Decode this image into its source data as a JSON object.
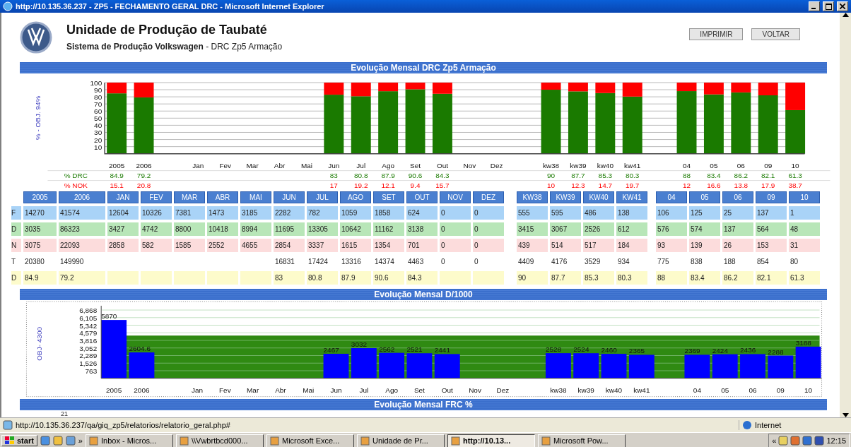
{
  "window": {
    "title": "http://10.135.36.237 - ZP5 - FECHAMENTO GERAL DRC - Microsoft Internet Explorer"
  },
  "header": {
    "title": "Unidade de Produção de Taubaté",
    "subtitle": "**Sistema de Produção Volkswagen** - DRC Zp5 Armação",
    "buttons": [
      "IMPRIMIR",
      "VOLTAR"
    ]
  },
  "drc_section": {
    "heading": "Evolução Mensal DRC Zp5 Armação",
    "chart_data": {
      "type": "bar",
      "stacked": true,
      "grid": true,
      "data_labels": true,
      "ylabel": "% - OBJ. 94%",
      "ylim": [
        0,
        100
      ],
      "yticks": [
        10,
        20,
        30,
        40,
        50,
        60,
        70,
        80,
        90,
        100
      ],
      "categories": [
        "2005",
        "2006",
        "Jan",
        "Fev",
        "Mar",
        "Abr",
        "Mai",
        "Jun",
        "Jul",
        "Ago",
        "Set",
        "Out",
        "Nov",
        "Dez",
        "kw38",
        "kw39",
        "kw40",
        "kw41",
        "04",
        "05",
        "06",
        "09",
        "10"
      ],
      "series": [
        {
          "name": "% DRC",
          "color": "#1a7a00",
          "values": [
            84.9,
            79.2,
            null,
            null,
            null,
            null,
            null,
            83,
            80.8,
            87.9,
            90.6,
            84.3,
            null,
            null,
            90,
            87.7,
            85.3,
            80.3,
            88,
            83.4,
            86.2,
            82.1,
            61.3
          ]
        },
        {
          "name": "% NOK",
          "color": "#ff0000",
          "values": [
            15.1,
            20.8,
            null,
            null,
            null,
            null,
            null,
            17,
            19.2,
            12.1,
            9.4,
            15.7,
            null,
            null,
            10,
            12.3,
            14.7,
            19.7,
            12,
            16.6,
            13.8,
            17.9,
            38.7
          ]
        }
      ]
    }
  },
  "table": {
    "columns": [
      "2005",
      "2006",
      "JAN",
      "FEV",
      "MAR",
      "ABR",
      "MAI",
      "JUN",
      "JUL",
      "AGO",
      "SET",
      "OUT",
      "NOV",
      "DEZ",
      "KW38",
      "KW39",
      "KW40",
      "KW41",
      "04",
      "05",
      "06",
      "09",
      "10"
    ],
    "rows": [
      {
        "label": "F",
        "color": "#a9d3f7",
        "cells": [
          "14270",
          "41574",
          "12604",
          "10326",
          "7381",
          "1473",
          "3185",
          "2282",
          "782",
          "1059",
          "1858",
          "624",
          "0",
          "0",
          "555",
          "595",
          "486",
          "138",
          "106",
          "125",
          "25",
          "137",
          "1"
        ]
      },
      {
        "label": "D",
        "color": "#b8e6b8",
        "cells": [
          "3035",
          "86323",
          "3427",
          "4742",
          "8800",
          "10418",
          "8994",
          "11695",
          "13305",
          "10642",
          "11162",
          "3138",
          "0",
          "0",
          "3415",
          "3067",
          "2526",
          "612",
          "576",
          "574",
          "137",
          "564",
          "48"
        ]
      },
      {
        "label": "N",
        "color": "#fcdcdc",
        "cells": [
          "3075",
          "22093",
          "2858",
          "582",
          "1585",
          "2552",
          "4655",
          "2854",
          "3337",
          "1615",
          "1354",
          "701",
          "0",
          "0",
          "439",
          "514",
          "517",
          "184",
          "93",
          "139",
          "26",
          "153",
          "31"
        ]
      },
      {
        "label": "T",
        "color": "#ffffff",
        "cells": [
          "20380",
          "149990",
          {
            "blank": true
          },
          {
            "blank": true
          },
          {
            "blank": true
          },
          {
            "blank": true
          },
          {
            "blank": true
          },
          "16831",
          "17424",
          "13316",
          "14374",
          "4463",
          "0",
          "0",
          "4409",
          "4176",
          "3529",
          "934",
          "775",
          "838",
          "188",
          "854",
          "80"
        ]
      },
      {
        "label": "D",
        "color": "#fdfbcb",
        "cells": [
          "84.9",
          "79.2",
          {
            "blank": true
          },
          {
            "blank": true
          },
          {
            "blank": true
          },
          {
            "blank": true
          },
          {
            "blank": true
          },
          "83",
          "80.8",
          "87.9",
          "90.6",
          "84.3",
          {
            "blank": true
          },
          {
            "blank": true
          },
          "90",
          "87.7",
          "85.3",
          "80.3",
          "88",
          "83.4",
          "86.2",
          "82.1",
          "61.3"
        ]
      }
    ]
  },
  "d1000_section": {
    "heading": "Evolução Mensal D/1000",
    "chart_data": {
      "type": "bar",
      "grid": true,
      "ylabel": "OBJ- 4300",
      "ylim": [
        0,
        7300
      ],
      "yticks": [
        {
          "value": 763,
          "label": "763"
        },
        {
          "value": 1526,
          "label": "1,526"
        },
        {
          "value": 2289,
          "label": "2,289"
        },
        {
          "value": 3052,
          "label": "3,052"
        },
        {
          "value": 3816,
          "label": "3,816"
        },
        {
          "value": 4579,
          "label": "4,579"
        },
        {
          "value": 5342,
          "label": "5,342"
        },
        {
          "value": 6105,
          "label": "6,105"
        },
        {
          "value": 6868,
          "label": "6,868"
        }
      ],
      "categories": [
        "2005",
        "2006",
        "Jan",
        "Fev",
        "Mar",
        "Abr",
        "Mai",
        "Jun",
        "Jul",
        "Ago",
        "Set",
        "Out",
        "Nov",
        "Dez",
        "kw38",
        "kw39",
        "kw40",
        "kw41",
        "04",
        "05",
        "06",
        "09",
        "10"
      ],
      "series": [
        {
          "color": "#0000ff",
          "values": [
            5870,
            2604.6,
            null,
            null,
            null,
            null,
            null,
            2467,
            3032,
            2562,
            2521,
            2441,
            null,
            null,
            2528,
            2524,
            2460,
            2365,
            2369,
            2424,
            2436,
            2288,
            3188
          ]
        }
      ],
      "value_labels": [
        "5870",
        "2604.6",
        null,
        null,
        null,
        null,
        null,
        "2467",
        "3032",
        "2562",
        "2521",
        "2441",
        null,
        null,
        "2528",
        "2524",
        "2460",
        "2365",
        "2369",
        "2424",
        "2436",
        "2288",
        "3188"
      ],
      "bands": [
        {
          "axis": "y",
          "from": 0,
          "to": 4300,
          "color": "#2f8a12"
        }
      ]
    }
  },
  "frc_section": {
    "heading": "Evolução Mensal FRC %",
    "first_tick": "21"
  },
  "status_bar": {
    "url": "http://10.135.36.237/qa/giq_zp5/relatorios/relatorio_geral.php#",
    "zone": "Internet"
  },
  "taskbar": {
    "start": "start",
    "more": "»",
    "tasks": [
      {
        "label": "Inbox - Micros...",
        "selected": false
      },
      {
        "label": "\\\\Vwbrtbcd000...",
        "selected": false
      },
      {
        "label": "Microsoft Exce...",
        "selected": false
      },
      {
        "label": "Unidade de Pr...",
        "selected": false
      },
      {
        "label": "http://10.13...",
        "selected": true
      },
      {
        "label": "Microsoft Pow...",
        "selected": false
      }
    ],
    "tray_expand": "«",
    "clock": "12:15"
  }
}
